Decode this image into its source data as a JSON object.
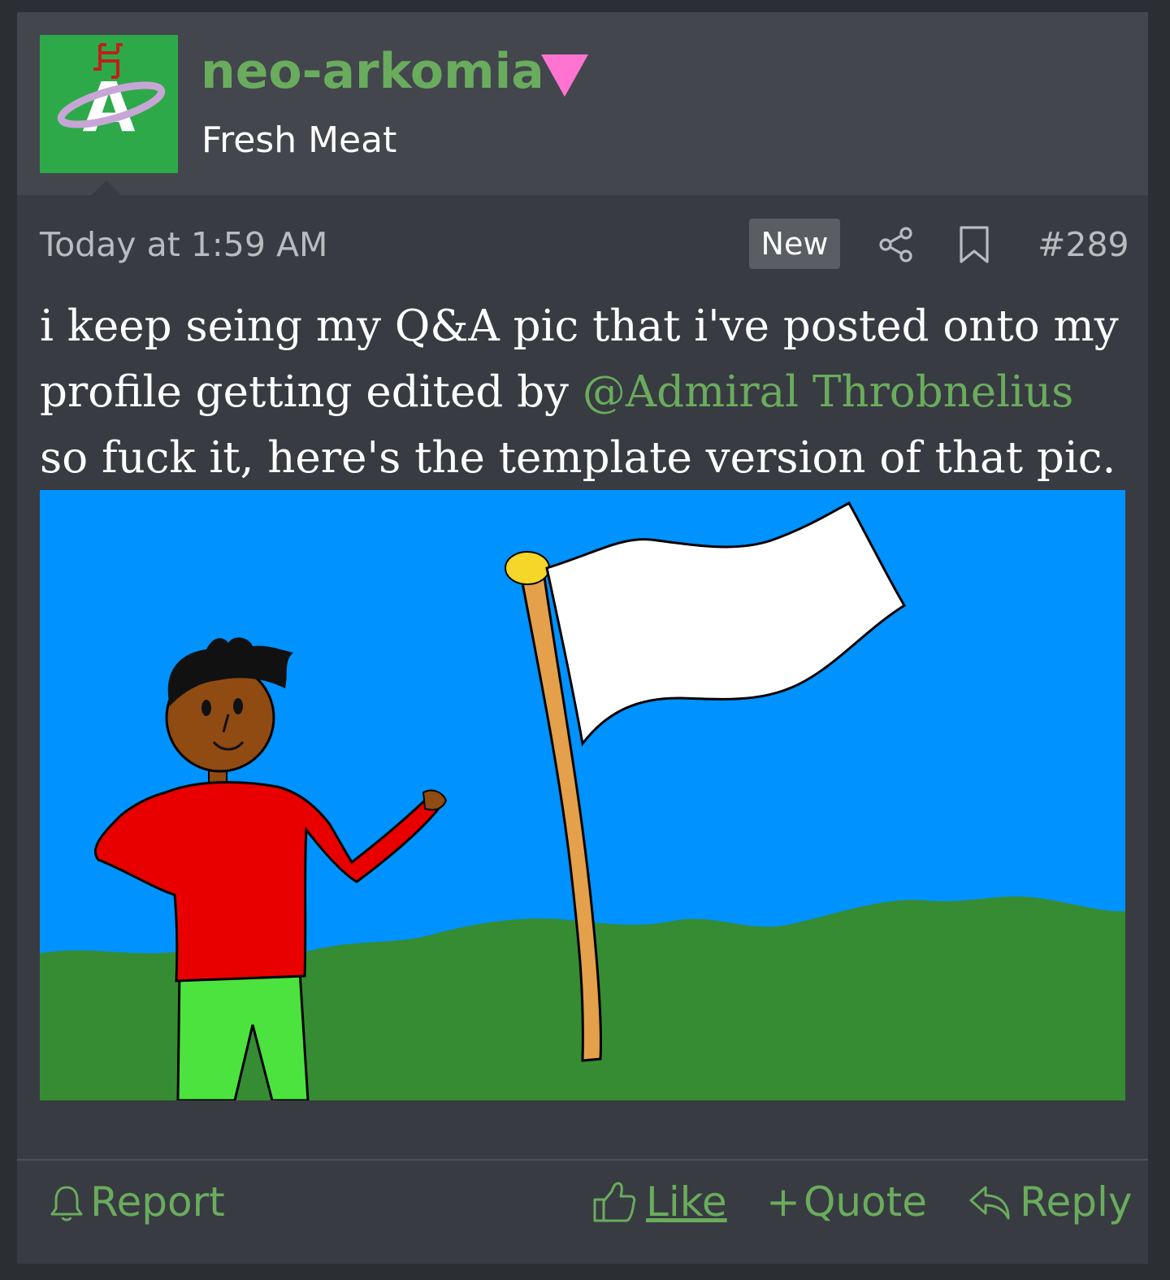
{
  "user": {
    "name": "neo-arkomia",
    "title": "Fresh Meat",
    "avatar_letter": "A",
    "avatar_bg": "#2ea949",
    "name_color": "#6aac5d",
    "gender_icon_color": "#ff73d1"
  },
  "meta": {
    "timestamp": "Today at 1:59 AM",
    "badge": "New",
    "post_number": "#289",
    "icons": [
      "share-icon",
      "bookmark-icon"
    ]
  },
  "message": {
    "text_before": "i keep seing my Q&A pic that i've posted onto my profile getting edited by ",
    "mention": "@Admiral Throbnelius",
    "text_after": " so fuck it, here's the template version of that pic."
  },
  "footer": {
    "report": "Report",
    "like": "Like",
    "quote": "Quote",
    "quote_prefix": "+",
    "reply": "Reply",
    "icons": [
      "bell-icon",
      "thumbs-up-icon",
      "reply-arrow-icon"
    ]
  },
  "colors": {
    "page_bg": "#2b2e33",
    "post_bg": "#383b41",
    "header_bg": "#43464d",
    "accent": "#6aac5d",
    "sky": "#0092ff",
    "grass": "#368c33"
  }
}
